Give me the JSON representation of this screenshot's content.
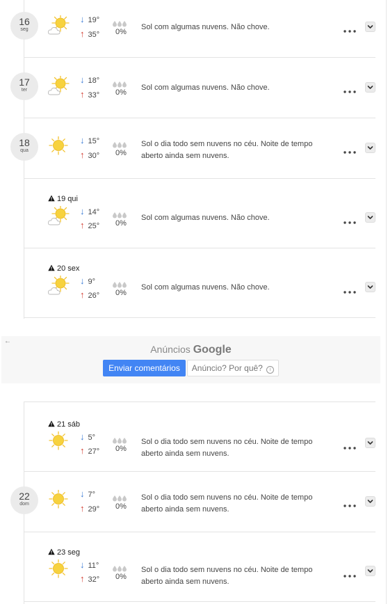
{
  "days": [
    {
      "num": "16",
      "abbr": "seg",
      "warning": null,
      "icon": "sun-cloud-icon",
      "min": "19°",
      "max": "35°",
      "precip": "0%",
      "desc": "Sol com algumas nuvens. Não chove."
    },
    {
      "num": "17",
      "abbr": "ter",
      "warning": null,
      "icon": "sun-cloud-icon",
      "min": "18°",
      "max": "33°",
      "precip": "0%",
      "desc": "Sol com algumas nuvens. Não chove."
    },
    {
      "num": "18",
      "abbr": "qua",
      "warning": null,
      "icon": "sun-icon",
      "min": "15°",
      "max": "30°",
      "precip": "0%",
      "desc": "Sol o dia todo sem nuvens no céu. Noite de tempo aberto ainda sem nuvens."
    },
    {
      "num": null,
      "abbr": null,
      "warning": "19 qui",
      "icon": "sun-cloud-icon",
      "min": "14°",
      "max": "25°",
      "precip": "0%",
      "desc": "Sol com algumas nuvens. Não chove."
    },
    {
      "num": null,
      "abbr": null,
      "warning": "20 sex",
      "icon": "sun-cloud-icon",
      "min": "9°",
      "max": "26°",
      "precip": "0%",
      "desc": "Sol com algumas nuvens. Não chove."
    },
    {
      "num": null,
      "abbr": null,
      "warning": "21 sáb",
      "icon": "sun-icon",
      "min": "5°",
      "max": "27°",
      "precip": "0%",
      "desc": "Sol o dia todo sem nuvens no céu. Noite de tempo aberto ainda sem nuvens."
    },
    {
      "num": "22",
      "abbr": "dom",
      "warning": null,
      "icon": "sun-icon",
      "min": "7°",
      "max": "29°",
      "precip": "0%",
      "desc": "Sol o dia todo sem nuvens no céu. Noite de tempo aberto ainda sem nuvens."
    },
    {
      "num": null,
      "abbr": null,
      "warning": "23 seg",
      "icon": "sun-icon",
      "min": "11°",
      "max": "32°",
      "precip": "0%",
      "desc": "Sol o dia todo sem nuvens no céu. Noite de tempo aberto ainda sem nuvens."
    }
  ],
  "ad": {
    "back_icon": "arrow-left-icon",
    "label": "Anúncios",
    "brand": "Google",
    "feedback_button": "Enviar comentários",
    "why_button": "Anúncio? Por quê?",
    "info_glyph": "i"
  },
  "colors": {
    "min_arrow": "#3a7bd5",
    "max_arrow": "#d13b2f",
    "ad_button": "#4285f4",
    "sun": "#f7d23e"
  }
}
